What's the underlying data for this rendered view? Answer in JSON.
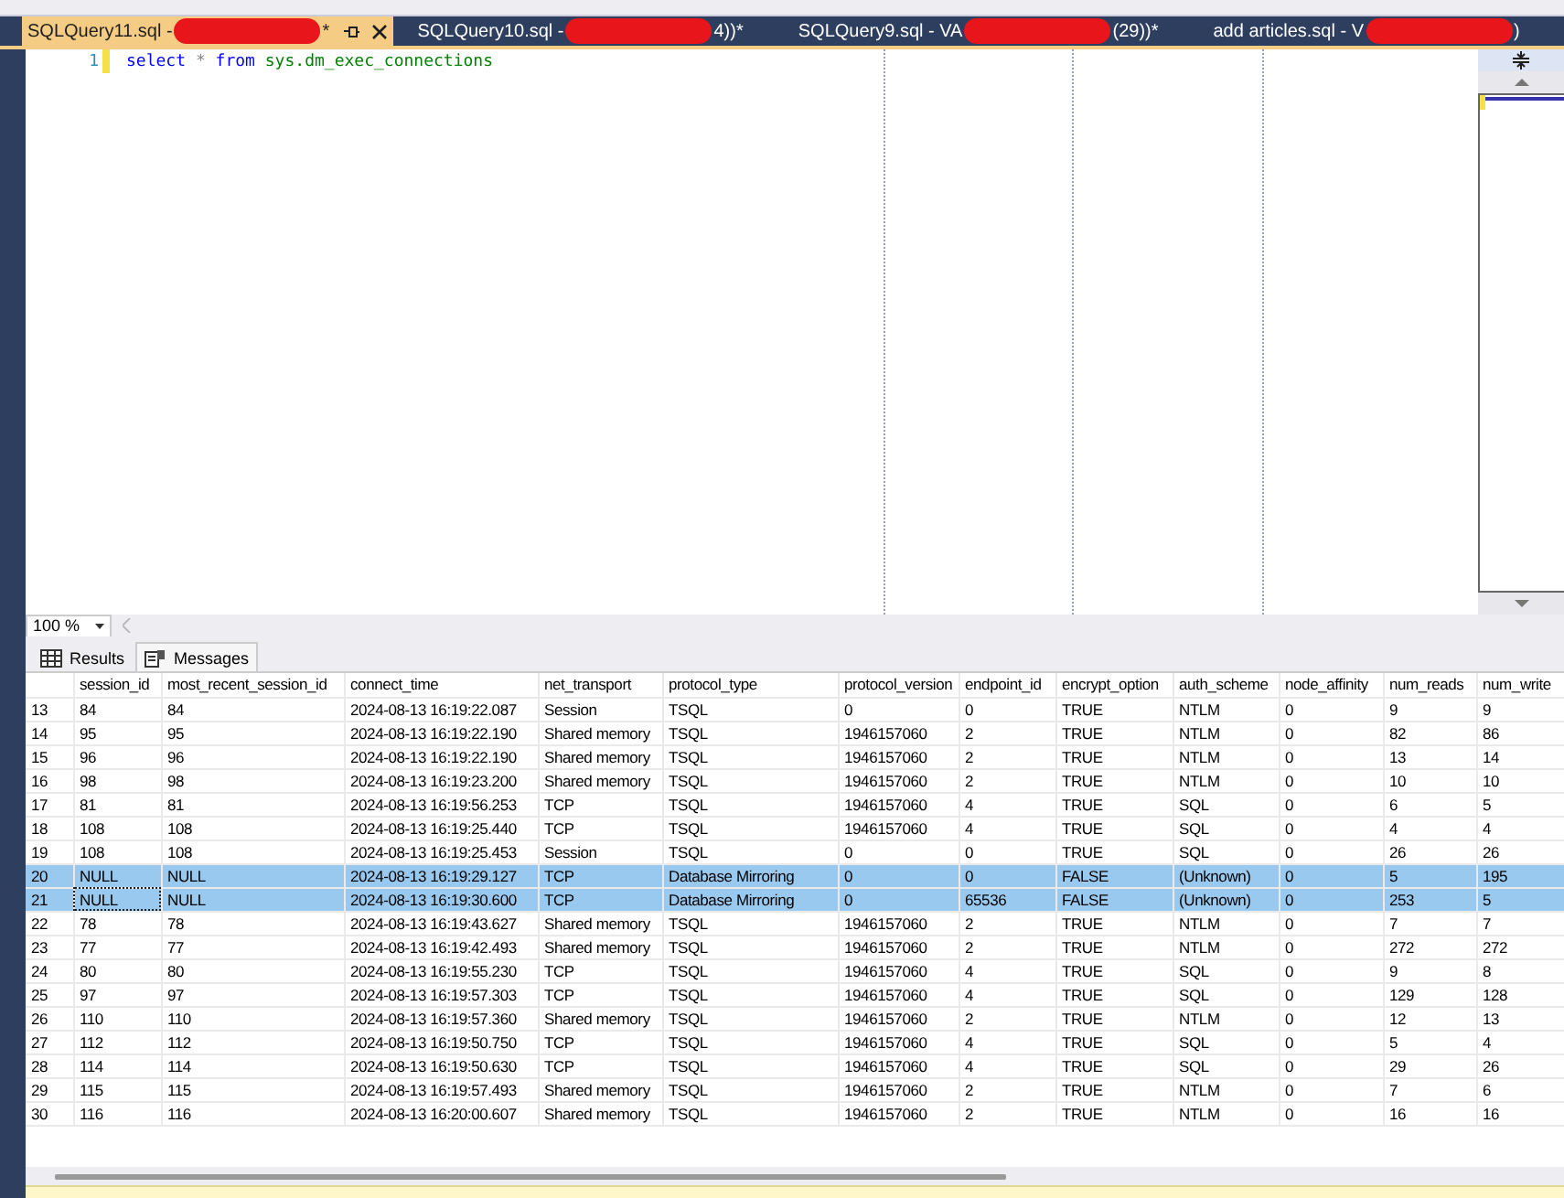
{
  "document_tabs": [
    {
      "title_before": "SQLQuery11.sql - ",
      "title_after": "*",
      "redacted": true,
      "selected": true
    },
    {
      "title_before": "SQLQuery10.sql - ",
      "title_after": "4))*",
      "redacted": true,
      "selected": false
    },
    {
      "title_before": "SQLQuery9.sql - VA",
      "title_after": "(29))*",
      "redacted": true,
      "selected": false
    },
    {
      "title_before": "add articles.sql - V",
      "title_after": ")",
      "redacted": true,
      "selected": false
    }
  ],
  "editor": {
    "lines": [
      {
        "number": "1",
        "modified": true,
        "tokens": [
          {
            "text": "select",
            "kind": "keyword"
          },
          {
            "text": "*",
            "kind": "operator"
          },
          {
            "text": "from",
            "kind": "keyword"
          },
          {
            "text": "sys.dm_exec_connections",
            "kind": "system"
          }
        ]
      }
    ]
  },
  "zoom": {
    "value": "100 %"
  },
  "results_tabs": [
    {
      "label": "Results",
      "kind": "grid",
      "selected": true
    },
    {
      "label": "Messages",
      "kind": "messages",
      "selected": false
    }
  ],
  "grid": {
    "columns": [
      "session_id",
      "most_recent_session_id",
      "connect_time",
      "net_transport",
      "protocol_type",
      "protocol_version",
      "endpoint_id",
      "encrypt_option",
      "auth_scheme",
      "node_affinity",
      "num_reads",
      "num_write"
    ],
    "rows": [
      {
        "row_number": "13",
        "selected": false,
        "focused": false,
        "cells": [
          "84",
          "84",
          "2024-08-13 16:19:22.087",
          "Session",
          "TSQL",
          "0",
          "0",
          "TRUE",
          "NTLM",
          "0",
          "9",
          "9"
        ]
      },
      {
        "row_number": "14",
        "selected": false,
        "focused": false,
        "cells": [
          "95",
          "95",
          "2024-08-13 16:19:22.190",
          "Shared memory",
          "TSQL",
          "1946157060",
          "2",
          "TRUE",
          "NTLM",
          "0",
          "82",
          "86"
        ]
      },
      {
        "row_number": "15",
        "selected": false,
        "focused": false,
        "cells": [
          "96",
          "96",
          "2024-08-13 16:19:22.190",
          "Shared memory",
          "TSQL",
          "1946157060",
          "2",
          "TRUE",
          "NTLM",
          "0",
          "13",
          "14"
        ]
      },
      {
        "row_number": "16",
        "selected": false,
        "focused": false,
        "cells": [
          "98",
          "98",
          "2024-08-13 16:19:23.200",
          "Shared memory",
          "TSQL",
          "1946157060",
          "2",
          "TRUE",
          "NTLM",
          "0",
          "10",
          "10"
        ]
      },
      {
        "row_number": "17",
        "selected": false,
        "focused": false,
        "cells": [
          "81",
          "81",
          "2024-08-13 16:19:56.253",
          "TCP",
          "TSQL",
          "1946157060",
          "4",
          "TRUE",
          "SQL",
          "0",
          "6",
          "5"
        ]
      },
      {
        "row_number": "18",
        "selected": false,
        "focused": false,
        "cells": [
          "108",
          "108",
          "2024-08-13 16:19:25.440",
          "TCP",
          "TSQL",
          "1946157060",
          "4",
          "TRUE",
          "SQL",
          "0",
          "4",
          "4"
        ]
      },
      {
        "row_number": "19",
        "selected": false,
        "focused": false,
        "cells": [
          "108",
          "108",
          "2024-08-13 16:19:25.453",
          "Session",
          "TSQL",
          "0",
          "0",
          "TRUE",
          "SQL",
          "0",
          "26",
          "26"
        ]
      },
      {
        "row_number": "20",
        "selected": true,
        "focused": false,
        "cells": [
          "NULL",
          "NULL",
          "2024-08-13 16:19:29.127",
          "TCP",
          "Database Mirroring",
          "0",
          "0",
          "FALSE",
          "(Unknown)",
          "0",
          "5",
          "195"
        ]
      },
      {
        "row_number": "21",
        "selected": true,
        "focused": true,
        "cells": [
          "NULL",
          "NULL",
          "2024-08-13 16:19:30.600",
          "TCP",
          "Database Mirroring",
          "0",
          "65536",
          "FALSE",
          "(Unknown)",
          "0",
          "253",
          "5"
        ]
      },
      {
        "row_number": "22",
        "selected": false,
        "focused": false,
        "cells": [
          "78",
          "78",
          "2024-08-13 16:19:43.627",
          "Shared memory",
          "TSQL",
          "1946157060",
          "2",
          "TRUE",
          "NTLM",
          "0",
          "7",
          "7"
        ]
      },
      {
        "row_number": "23",
        "selected": false,
        "focused": false,
        "cells": [
          "77",
          "77",
          "2024-08-13 16:19:42.493",
          "Shared memory",
          "TSQL",
          "1946157060",
          "2",
          "TRUE",
          "NTLM",
          "0",
          "272",
          "272"
        ]
      },
      {
        "row_number": "24",
        "selected": false,
        "focused": false,
        "cells": [
          "80",
          "80",
          "2024-08-13 16:19:55.230",
          "TCP",
          "TSQL",
          "1946157060",
          "4",
          "TRUE",
          "SQL",
          "0",
          "9",
          "8"
        ]
      },
      {
        "row_number": "25",
        "selected": false,
        "focused": false,
        "cells": [
          "97",
          "97",
          "2024-08-13 16:19:57.303",
          "TCP",
          "TSQL",
          "1946157060",
          "4",
          "TRUE",
          "SQL",
          "0",
          "129",
          "128"
        ]
      },
      {
        "row_number": "26",
        "selected": false,
        "focused": false,
        "cells": [
          "110",
          "110",
          "2024-08-13 16:19:57.360",
          "Shared memory",
          "TSQL",
          "1946157060",
          "2",
          "TRUE",
          "NTLM",
          "0",
          "12",
          "13"
        ]
      },
      {
        "row_number": "27",
        "selected": false,
        "focused": false,
        "cells": [
          "112",
          "112",
          "2024-08-13 16:19:50.750",
          "TCP",
          "TSQL",
          "1946157060",
          "4",
          "TRUE",
          "SQL",
          "0",
          "5",
          "4"
        ]
      },
      {
        "row_number": "28",
        "selected": false,
        "focused": false,
        "cells": [
          "114",
          "114",
          "2024-08-13 16:19:50.630",
          "TCP",
          "TSQL",
          "1946157060",
          "4",
          "TRUE",
          "SQL",
          "0",
          "29",
          "26"
        ]
      },
      {
        "row_number": "29",
        "selected": false,
        "focused": false,
        "cells": [
          "115",
          "115",
          "2024-08-13 16:19:57.493",
          "Shared memory",
          "TSQL",
          "1946157060",
          "2",
          "TRUE",
          "NTLM",
          "0",
          "7",
          "6"
        ]
      },
      {
        "row_number": "30",
        "selected": false,
        "focused": false,
        "cells": [
          "116",
          "116",
          "2024-08-13 16:20:00.607",
          "Shared memory",
          "TSQL",
          "1946157060",
          "2",
          "TRUE",
          "NTLM",
          "0",
          "16",
          "16"
        ]
      }
    ]
  }
}
